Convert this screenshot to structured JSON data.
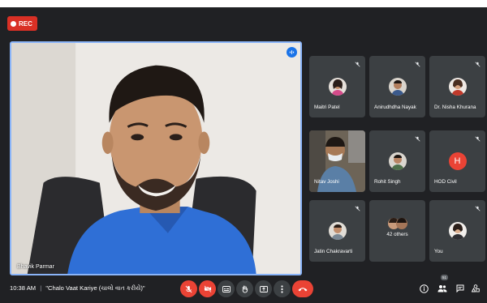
{
  "recording": {
    "label": "REC"
  },
  "main_video": {
    "name": "Bhavik Parmar"
  },
  "participants": [
    {
      "name": "Maitri Patel",
      "avatar": "photo-woman",
      "muted": true
    },
    {
      "name": "Anirudhdha Nayak",
      "avatar": "photo-man",
      "muted": true
    },
    {
      "name": "Dr. Nisha Khurana",
      "avatar": "photo-woman",
      "muted": true
    },
    {
      "name": "Nitav Joshi",
      "avatar": "video",
      "muted": false
    },
    {
      "name": "Rohit Singh",
      "avatar": "photo-man",
      "muted": true
    },
    {
      "name": "HOD Civil",
      "avatar": "letter",
      "letter": "H",
      "muted": true
    },
    {
      "name": "Jatin Chakravarti",
      "avatar": "photo-man",
      "muted": true
    },
    {
      "name": "42 others",
      "avatar": "group",
      "muted": false
    },
    {
      "name": "You",
      "avatar": "photo-woman",
      "muted": true
    }
  ],
  "bottom_bar": {
    "time": "10:38 AM",
    "separator": "|",
    "meeting_title": "\"Chalo Vaat Kariye (ચાલો વાત કરીયે)\"",
    "people_count": "51"
  },
  "colors": {
    "end_call": "#ea4335",
    "active_speaker": "#8ab4f8",
    "tile": "#3c4043",
    "background": "#202124"
  },
  "icons": [
    "mic-off-icon",
    "camera-off-icon",
    "captions-icon",
    "raise-hand-icon",
    "present-icon",
    "more-options-icon",
    "end-call-icon",
    "info-icon",
    "people-icon",
    "chat-icon",
    "activities-icon"
  ]
}
